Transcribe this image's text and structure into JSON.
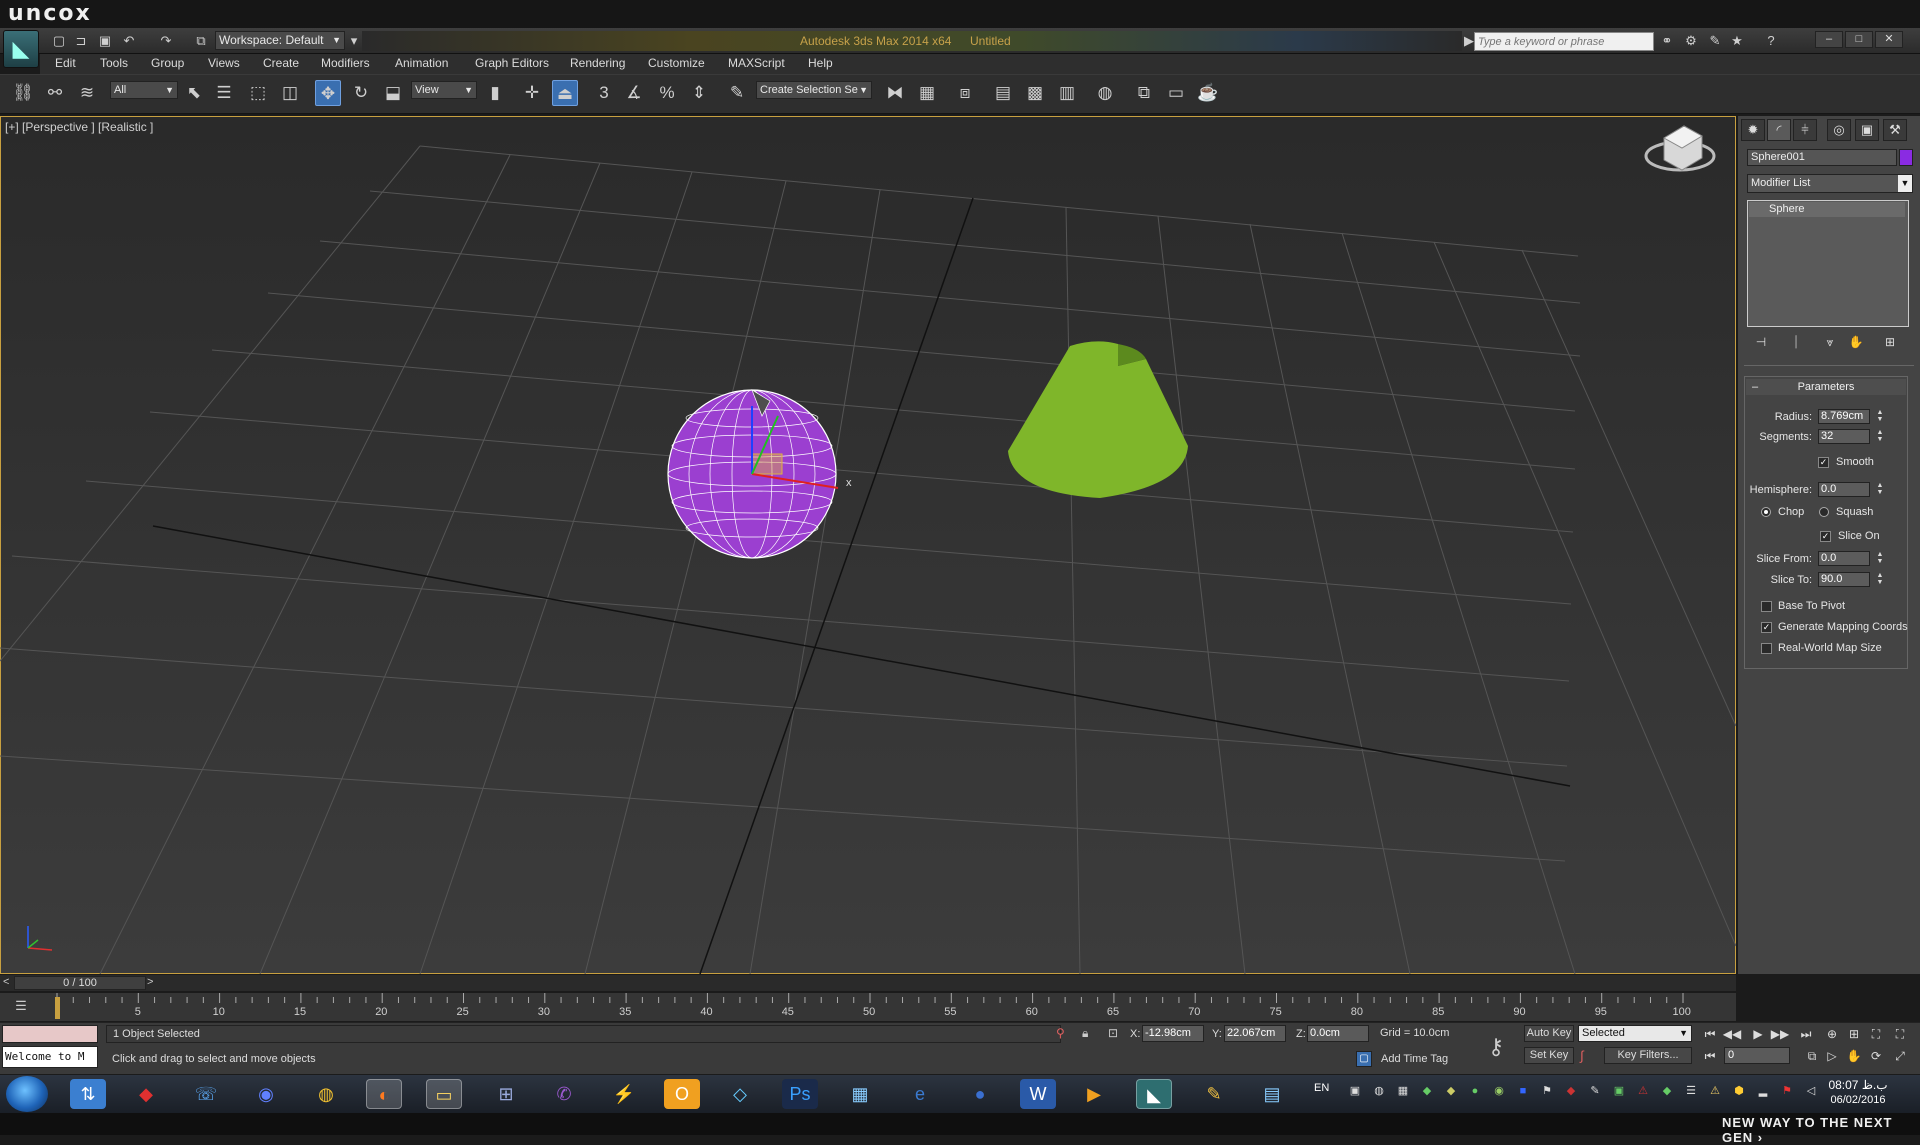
{
  "banner": {
    "brand": "uncox",
    "tagline": "NEW WAY TO THE NEXT GEN ›"
  },
  "titlebar": {
    "app_title": "Autodesk 3ds Max  2014 x64",
    "doc_title": "Untitled",
    "workspace": "Workspace: Default",
    "search_placeholder": "Type a keyword or phrase"
  },
  "menu": [
    "Edit",
    "Tools",
    "Group",
    "Views",
    "Create",
    "Modifiers",
    "Animation",
    "Graph Editors",
    "Rendering",
    "Customize",
    "MAXScript",
    "Help"
  ],
  "toolbar": {
    "selection_filter": "All",
    "ref_coord": "View",
    "named_selection": "Create Selection Se",
    "snap_label": "3"
  },
  "viewport": {
    "label": "[+] [Perspective ] [Realistic ]",
    "sphere_color": "#9b3fd0",
    "cone_color": "#7fb62a",
    "gizmo_x_label": "x"
  },
  "command_panel": {
    "object_name": "Sphere001",
    "object_color": "#8a2be2",
    "modifier_list": "Modifier List",
    "stack_item": "Sphere",
    "rollout_title": "Parameters",
    "radius_label": "Radius:",
    "radius": "8.769cm",
    "segments_label": "Segments:",
    "segments": "32",
    "smooth_label": "Smooth",
    "smooth": true,
    "hemisphere_label": "Hemisphere:",
    "hemisphere": "0.0",
    "chop_label": "Chop",
    "squash_label": "Squash",
    "chop_selected": true,
    "slice_on_label": "Slice On",
    "slice_on": true,
    "slice_from_label": "Slice From:",
    "slice_from": "0.0",
    "slice_to_label": "Slice To:",
    "slice_to": "90.0",
    "base_to_pivot_label": "Base To Pivot",
    "base_to_pivot": false,
    "gen_mapping_label": "Generate Mapping Coords",
    "gen_mapping": true,
    "real_world_label": "Real-World Map Size",
    "real_world": false
  },
  "timeline": {
    "frame_display": "0 / 100",
    "ticks": [
      "5",
      "10",
      "15",
      "20",
      "25",
      "30",
      "35",
      "40",
      "45",
      "50",
      "55",
      "60",
      "65",
      "70",
      "75",
      "80",
      "85",
      "90",
      "95",
      "100"
    ]
  },
  "status": {
    "welcome": "Welcome to M",
    "objects_selected": "1 Object Selected",
    "prompt": "Click and drag to select and move objects",
    "x_label": "X:",
    "x": "-12.98cm",
    "y_label": "Y:",
    "y": "22.067cm",
    "z_label": "Z:",
    "z": "0.0cm",
    "grid": "Grid = 10.0cm",
    "add_time_tag": "Add Time Tag",
    "auto_key": "Auto Key",
    "set_key": "Set Key",
    "selected": "Selected",
    "key_filters": "Key Filters...",
    "current_frame": "0"
  },
  "taskbar": {
    "lang": "EN",
    "time": "08:07 ب.ظ",
    "date": "06/02/2016"
  }
}
